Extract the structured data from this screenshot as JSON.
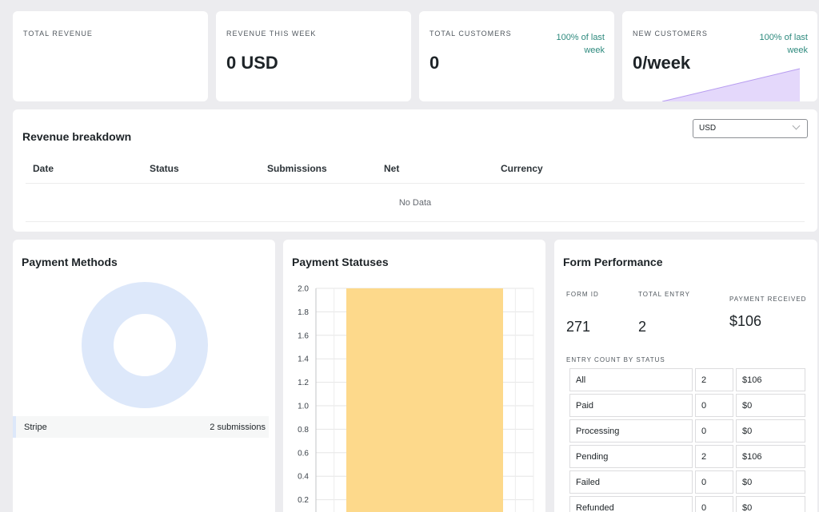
{
  "stats": [
    {
      "label": "TOTAL REVENUE",
      "value": "",
      "change": ""
    },
    {
      "label": "REVENUE THIS WEEK",
      "value": "0 USD",
      "change": ""
    },
    {
      "label": "TOTAL CUSTOMERS",
      "value": "0",
      "change": "100% of last week"
    },
    {
      "label": "NEW CUSTOMERS",
      "value": "0/week",
      "change": "100% of last week"
    }
  ],
  "revenue": {
    "title": "Revenue breakdown",
    "currency_selected": "USD",
    "columns": [
      "Date",
      "Status",
      "Submissions",
      "Net",
      "Currency"
    ],
    "empty_text": "No Data"
  },
  "payment_methods": {
    "title": "Payment Methods",
    "legend": [
      {
        "name": "Stripe",
        "count": "2 submissions"
      }
    ],
    "colors": {
      "donut": "#dde8fa"
    }
  },
  "payment_statuses": {
    "title": "Payment Statuses",
    "chart_data": {
      "type": "bar",
      "categories": [
        ""
      ],
      "values": [
        2
      ],
      "ylim": [
        0,
        2
      ],
      "yticks": [
        "2.0",
        "1.8",
        "1.6",
        "1.4",
        "1.2",
        "1.0",
        "0.8",
        "0.6",
        "0.4",
        "0.2"
      ],
      "grid": true,
      "bar_color": "#fdd98b"
    }
  },
  "form_performance": {
    "title": "Form Performance",
    "form_id_label": "FORM ID",
    "form_id": "271",
    "total_entry_label": "TOTAL ENTRY",
    "total_entry": "2",
    "payment_received_label": "PAYMENT RECEIVED",
    "payment_received": "$106",
    "status_label": "ENTRY COUNT BY STATUS",
    "rows": [
      [
        "All",
        "2",
        "$106"
      ],
      [
        "Paid",
        "0",
        "$0"
      ],
      [
        "Processing",
        "0",
        "$0"
      ],
      [
        "Pending",
        "2",
        "$106"
      ],
      [
        "Failed",
        "0",
        "$0"
      ],
      [
        "Refunded",
        "0",
        "$0"
      ]
    ]
  }
}
